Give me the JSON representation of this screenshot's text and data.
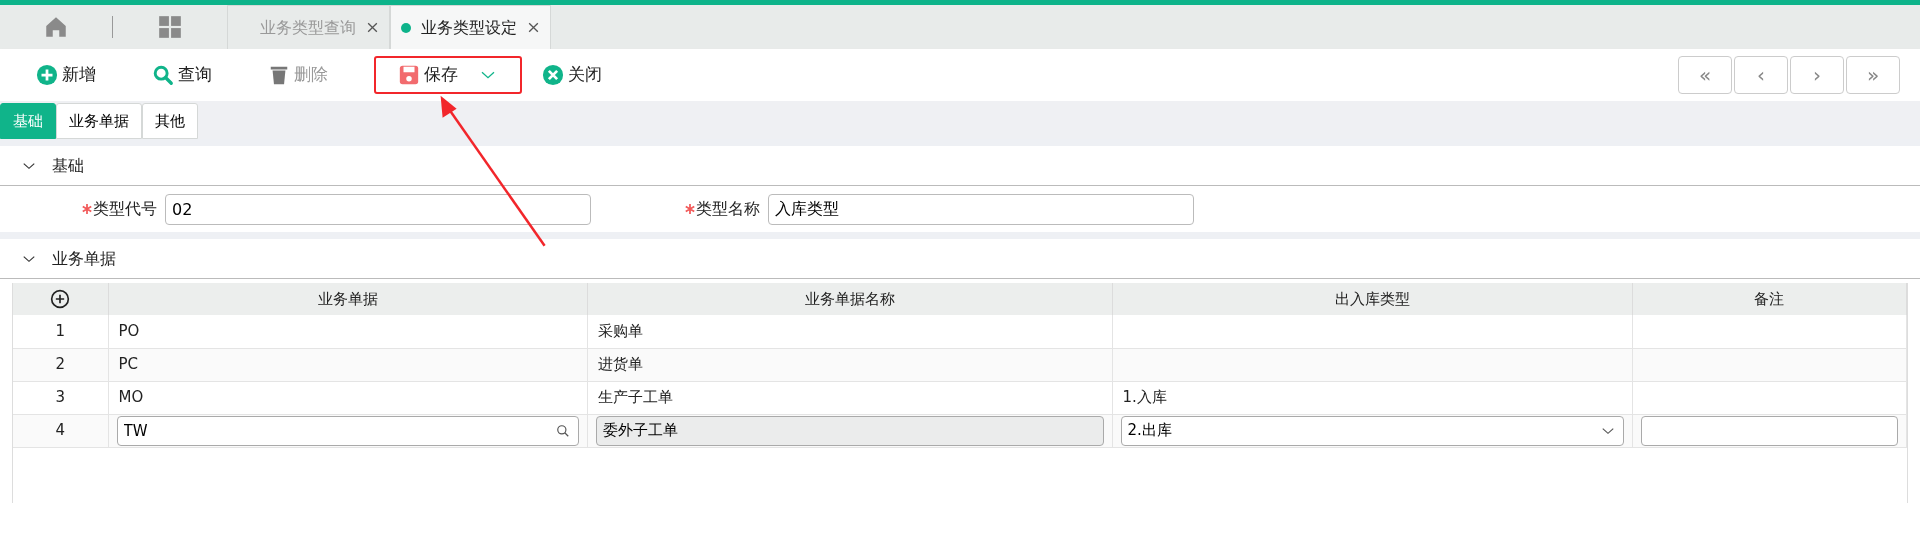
{
  "page_tabs": [
    {
      "label": "业务类型查询",
      "selected": false
    },
    {
      "label": "业务类型设定",
      "selected": true
    }
  ],
  "toolbar": [
    {
      "kind": "add",
      "label": "新增",
      "disabled": false,
      "highlighted": false,
      "dropdown": false
    },
    {
      "kind": "search",
      "label": "查询",
      "disabled": false,
      "highlighted": false,
      "dropdown": false
    },
    {
      "kind": "delete",
      "label": "删除",
      "disabled": true,
      "highlighted": false,
      "dropdown": false
    },
    {
      "kind": "save",
      "label": "保存",
      "disabled": false,
      "highlighted": true,
      "dropdown": true
    },
    {
      "kind": "close",
      "label": "关闭",
      "disabled": false,
      "highlighted": false,
      "dropdown": false
    }
  ],
  "pager": [
    "«",
    "‹",
    "›",
    "»"
  ],
  "sub_tabs": [
    {
      "label": "基础",
      "selected": true
    },
    {
      "label": "业务单据",
      "selected": false
    },
    {
      "label": "其他",
      "selected": false
    }
  ],
  "sections": [
    {
      "kind": "form",
      "title": "基础",
      "expanded": true,
      "fields": [
        {
          "label": "类型代号",
          "required": true,
          "value": "02"
        },
        {
          "label": "类型名称",
          "required": true,
          "value": "入库类型"
        }
      ]
    },
    {
      "kind": "grid",
      "title": "业务单据",
      "expanded": true,
      "columns": [
        "业务单据",
        "业务单据名称",
        "出入库类型",
        "备注"
      ],
      "rows": [
        {
          "index": "1",
          "cells": [
            {
              "kind": "text",
              "value": "PO"
            },
            {
              "kind": "text",
              "value": "采购单"
            },
            {
              "kind": "text"
            },
            {
              "kind": "text"
            }
          ]
        },
        {
          "index": "2",
          "cells": [
            {
              "kind": "text",
              "value": "PC"
            },
            {
              "kind": "text",
              "value": "进货单"
            },
            {
              "kind": "text"
            },
            {
              "kind": "text"
            }
          ]
        },
        {
          "index": "3",
          "cells": [
            {
              "kind": "text",
              "value": "MO"
            },
            {
              "kind": "text",
              "value": "生产子工单"
            },
            {
              "kind": "text",
              "value": "1.入库"
            },
            {
              "kind": "text"
            }
          ]
        },
        {
          "index": "4",
          "cells": [
            {
              "kind": "lookup",
              "value": "TW"
            },
            {
              "kind": "readonly",
              "value": "委外子工单"
            },
            {
              "kind": "select",
              "value": "2.出库"
            },
            {
              "kind": "input"
            }
          ]
        }
      ]
    }
  ]
}
